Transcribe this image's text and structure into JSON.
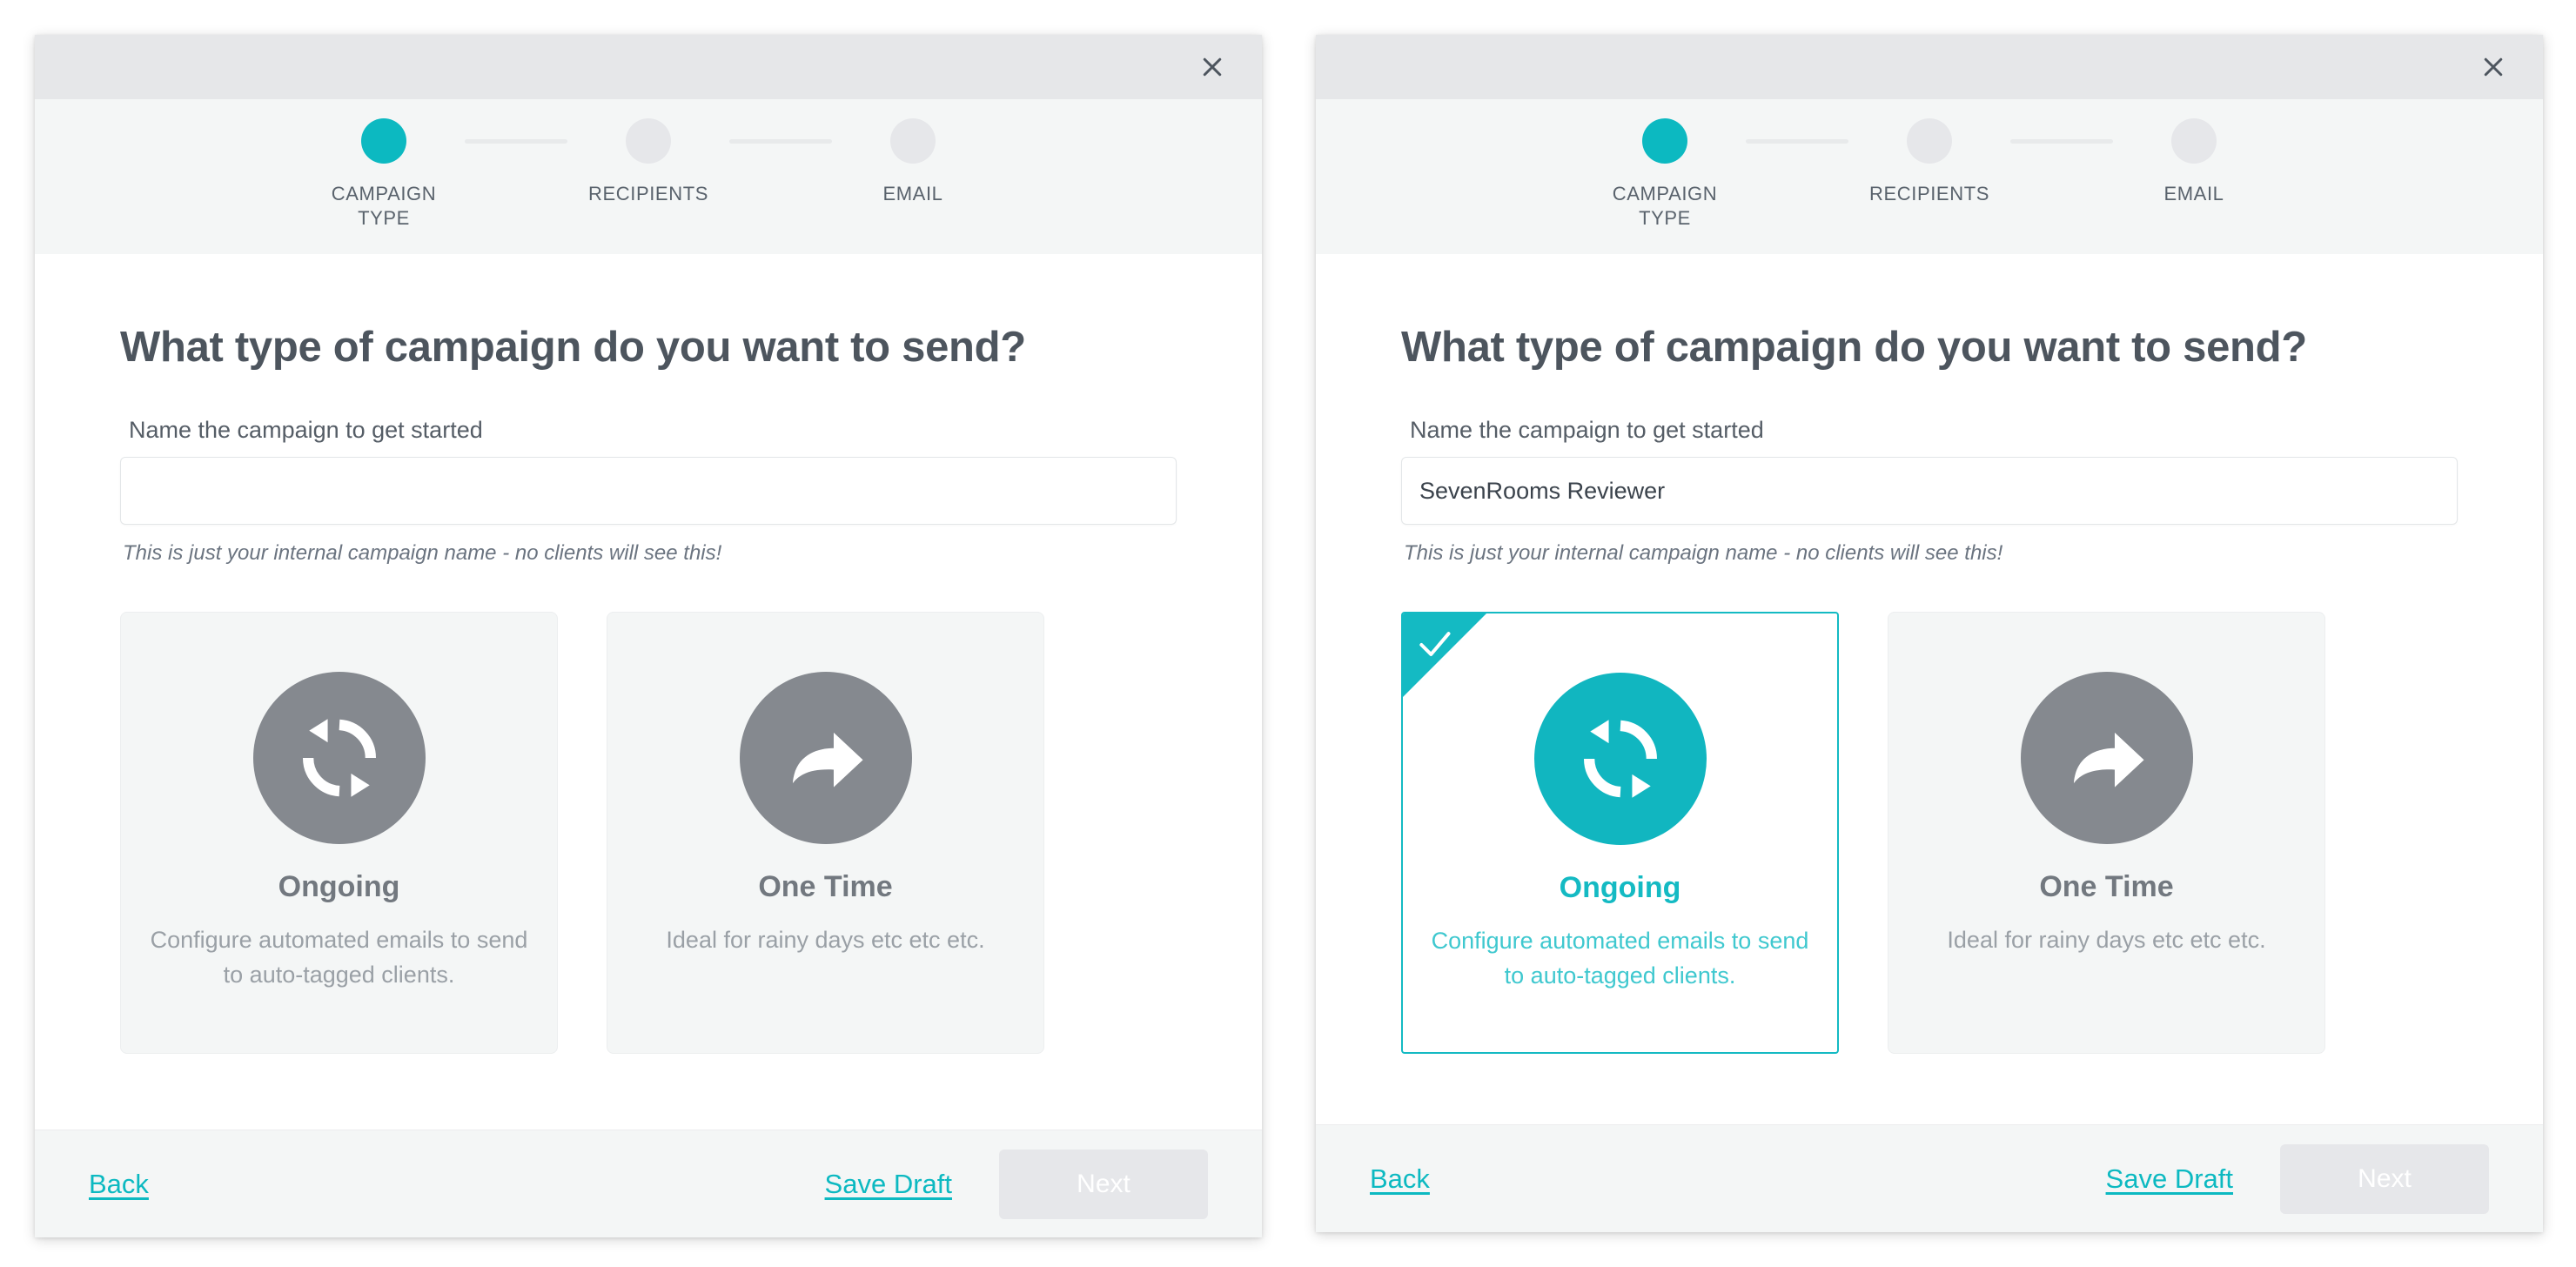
{
  "accent_color": "#0cb9c1",
  "heading_color": "#4d555e",
  "muted_color": "#85898f",
  "panels": [
    {
      "id": "left",
      "close_icon": "close-icon",
      "stepper": {
        "steps": [
          {
            "label": "CAMPAIGN TYPE",
            "active": true
          },
          {
            "label": "RECIPIENTS",
            "active": false
          },
          {
            "label": "EMAIL",
            "active": false
          }
        ]
      },
      "headline": "What type of campaign do you want to send?",
      "field": {
        "label": "Name the campaign to get started",
        "value": "",
        "placeholder": "",
        "helper": "This is just your internal campaign name - no clients will see this!",
        "caret_visible": true
      },
      "cards": [
        {
          "title": "Ongoing",
          "description": "Configure automated emails to send to auto-tagged clients.",
          "icon": "sync-refresh-icon",
          "selected": false
        },
        {
          "title": "One Time",
          "description": "Ideal for rainy days etc etc etc.",
          "icon": "share-arrow-icon",
          "selected": false
        }
      ],
      "footer": {
        "back_label": "Back",
        "save_draft_label": "Save Draft",
        "next_label": "Next"
      }
    },
    {
      "id": "right",
      "close_icon": "close-icon",
      "stepper": {
        "steps": [
          {
            "label": "CAMPAIGN TYPE",
            "active": true
          },
          {
            "label": "RECIPIENTS",
            "active": false
          },
          {
            "label": "EMAIL",
            "active": false
          }
        ]
      },
      "headline": "What type of campaign do you want to send?",
      "field": {
        "label": "Name the campaign to get started",
        "value": "SevenRooms Reviewer",
        "placeholder": "",
        "helper": "This is just your internal campaign name - no clients will see this!",
        "caret_visible": false
      },
      "cards": [
        {
          "title": "Ongoing",
          "description": "Configure automated emails to send to auto-tagged clients.",
          "icon": "sync-refresh-icon",
          "selected": true,
          "check_icon": "check-icon"
        },
        {
          "title": "One Time",
          "description": "Ideal for rainy days etc etc etc.",
          "icon": "share-arrow-icon",
          "selected": false
        }
      ],
      "footer": {
        "back_label": "Back",
        "save_draft_label": "Save Draft",
        "next_label": "Next"
      }
    }
  ]
}
